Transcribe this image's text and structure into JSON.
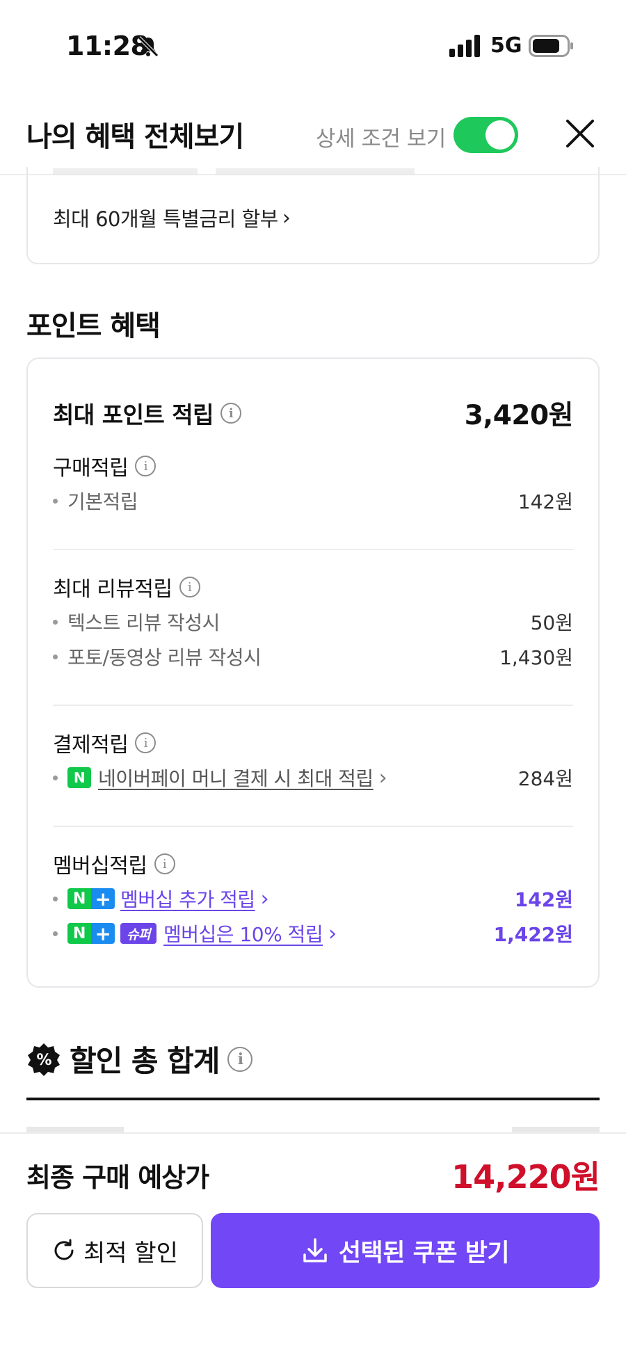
{
  "status_bar": {
    "time": "11:28",
    "network": "5G"
  },
  "header": {
    "title": "나의 혜택 전체보기",
    "toggle_label": "상세 조건 보기",
    "toggle_on": true
  },
  "installment": {
    "label": "최대 60개월 특별금리 할부"
  },
  "points": {
    "section_title": "포인트 혜택",
    "max_label": "최대 포인트 적립",
    "max_total": "3,420원",
    "purchase": {
      "title": "구매적립",
      "items": [
        {
          "label": "기본적립",
          "amount": "142원"
        }
      ]
    },
    "review": {
      "title": "최대 리뷰적립",
      "items": [
        {
          "label": "텍스트 리뷰 작성시",
          "amount": "50원"
        },
        {
          "label": "포토/동영상 리뷰 작성시",
          "amount": "1,430원"
        }
      ]
    },
    "payment": {
      "title": "결제적립",
      "badge": "N",
      "link": "네이버페이 머니 결제 시 최대 적립",
      "amount": "284원"
    },
    "membership": {
      "title": "멤버십적립",
      "badge_n": "N",
      "badge_plus": "+",
      "badge_super": "슈퍼",
      "items": [
        {
          "link": "멤버십 추가 적립",
          "amount": "142원"
        },
        {
          "link": "멤버십은 10% 적립",
          "amount": "1,422원"
        }
      ]
    }
  },
  "discount": {
    "title": "할인 총 합계",
    "icon_text": "%"
  },
  "bottom": {
    "final_label": "최종 구매 예상가",
    "final_price": "14,220원",
    "optimal_button": "최적 할인",
    "coupon_button": "선택된 쿠폰 받기"
  },
  "colors": {
    "accent": "#7247f5",
    "toggle": "#1ec85a",
    "price": "#d0102b",
    "membership": "#6b45e8"
  }
}
